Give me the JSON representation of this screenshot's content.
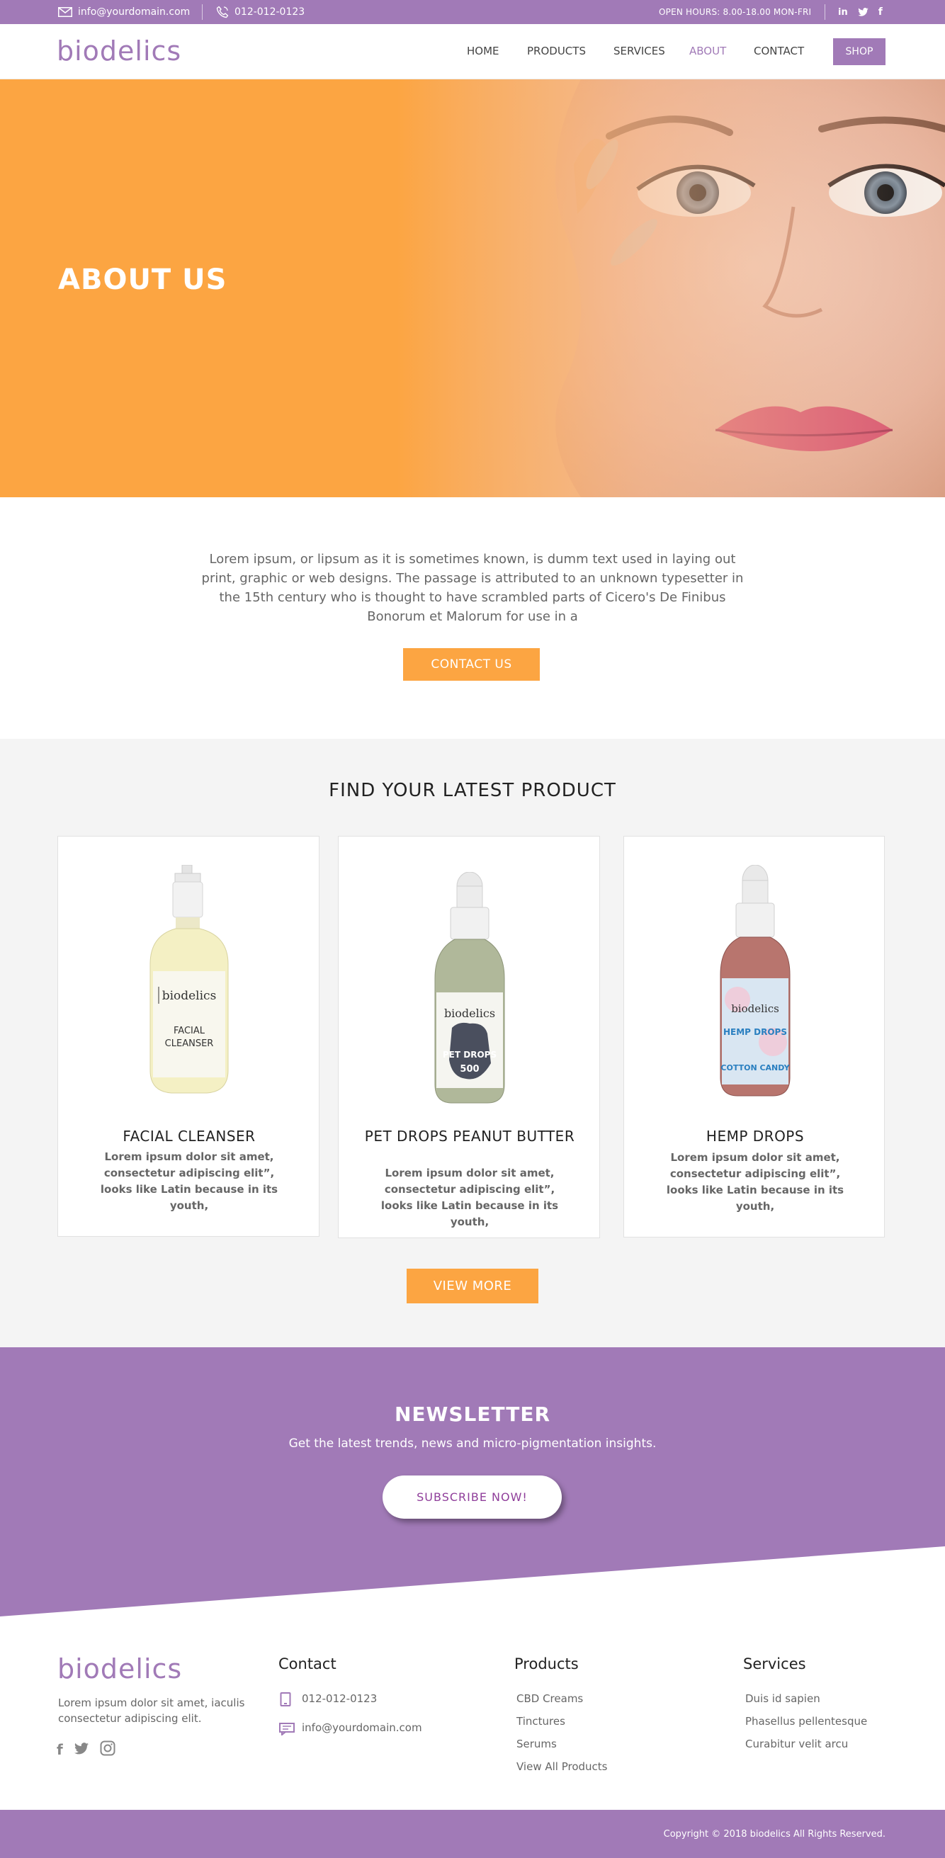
{
  "topbar": {
    "email": "info@yourdomain.com",
    "phone": "012-012-0123",
    "hours": "OPEN HOURS: 8.00-18.00 MON-FRI",
    "social": [
      "in",
      "twitter",
      "f"
    ]
  },
  "brand": {
    "logo": "biodelics"
  },
  "nav": {
    "items": [
      "HOME",
      "PRODUCTS",
      "SERVICES",
      "ABOUT",
      "CONTACT"
    ],
    "active": "ABOUT",
    "shop": "SHOP"
  },
  "hero": {
    "title": "ABOUT US"
  },
  "intro": {
    "text": "Lorem ipsum, or lipsum as it is sometimes known, is dumm  text used in laying out print, graphic or web designs. The passage is attributed to an unknown typesetter in the 15th century who is thought to have scrambled parts of Cicero's De Finibus Bonorum et Malorum for use in a",
    "button": "CONTACT US"
  },
  "products": {
    "heading": "FIND YOUR LATEST PRODUCT",
    "items": [
      {
        "name": "FACIAL CLEANSER",
        "desc": "Lorem ipsum dolor sit amet, consectetur adipiscing elit”, looks like Latin because in its youth,",
        "label_brand": "biodelics",
        "label_line1": "FACIAL",
        "label_line2": "CLEANSER"
      },
      {
        "name": "PET DROPS PEANUT BUTTER",
        "desc": "Lorem ipsum dolor sit amet, consectetur adipiscing elit”, looks like Latin because in its youth,",
        "label_brand": "biodelics",
        "label_line1": "PET DROPS",
        "label_line2": "500"
      },
      {
        "name": "HEMP DROPS",
        "desc": "Lorem ipsum dolor sit amet, consectetur adipiscing elit”, looks like Latin because in its youth,",
        "label_brand": "biodelics",
        "label_line1": "HEMP DROPS",
        "label_line2": "COTTON CANDY"
      }
    ],
    "button": "VIEW MORE"
  },
  "newsletter": {
    "title": "NEWSLETTER",
    "subtitle": "Get the latest trends, news and micro-pigmentation insights.",
    "button": "SUBSCRIBE NOW!"
  },
  "footer": {
    "logo": "biodelics",
    "description": "Lorem ipsum dolor sit amet, iaculis consectetur adipiscing elit.",
    "contact": {
      "heading": "Contact",
      "phone": "012-012-0123",
      "email": "info@yourdomain.com"
    },
    "products": {
      "heading": "Products",
      "links": [
        "CBD Creams",
        "Tinctures",
        "Serums",
        "View All Products"
      ]
    },
    "services": {
      "heading": "Services",
      "links": [
        "Duis id sapien",
        "Phasellus pellentesque",
        "Curabitur velit arcu"
      ]
    },
    "copyright": "Copyright © 2018  biodelics  All Rights Reserved."
  },
  "colors": {
    "brand_purple": "#a17ab7",
    "accent_orange": "#fca542",
    "section_gray": "#f4f4f4"
  }
}
